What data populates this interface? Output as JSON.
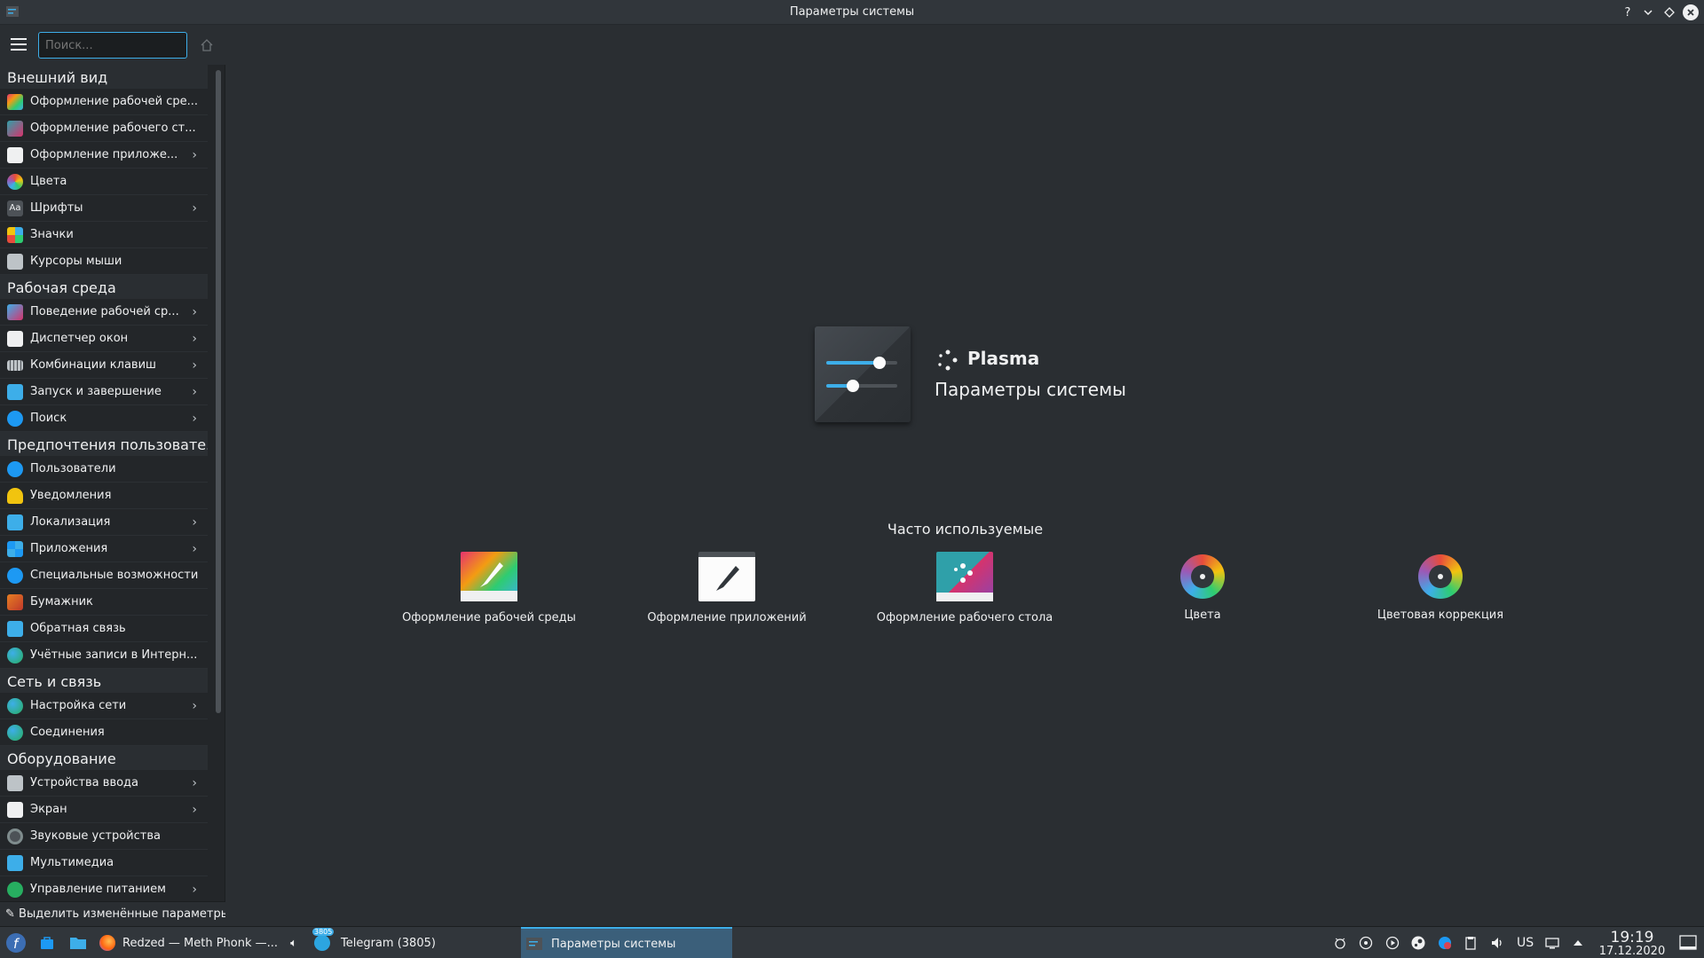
{
  "window": {
    "title": "Параметры системы"
  },
  "search": {
    "placeholder": "Поиск..."
  },
  "sidebar": {
    "groups": [
      {
        "header": "Внешний вид",
        "items": [
          {
            "label": "Оформление рабочей сре...",
            "icon": "global-theme-icon",
            "color": "#e5326f",
            "arrow": false
          },
          {
            "label": "Оформление рабочего ст...",
            "icon": "plasma-style-icon",
            "color": "#2fa0a9",
            "arrow": false
          },
          {
            "label": "Оформление приложе...",
            "icon": "application-style-icon",
            "color": "#eff0f1",
            "arrow": true
          },
          {
            "label": "Цвета",
            "icon": "colors-icon",
            "color": "#c83ae0",
            "arrow": false
          },
          {
            "label": "Шрифты",
            "icon": "fonts-icon",
            "color": "#4d5257",
            "arrow": true
          },
          {
            "label": "Значки",
            "icon": "icons-icon",
            "color": "#3daee9",
            "arrow": false
          },
          {
            "label": "Курсоры мыши",
            "icon": "cursor-icon",
            "color": "#bdc3c7",
            "arrow": false
          }
        ]
      },
      {
        "header": "Рабочая среда",
        "items": [
          {
            "label": "Поведение рабочей ср...",
            "icon": "workspace-behavior-icon",
            "color": "#3daee9",
            "arrow": true
          },
          {
            "label": "Диспетчер окон",
            "icon": "window-manager-icon",
            "color": "#eff0f1",
            "arrow": true
          },
          {
            "label": "Комбинации клавиш",
            "icon": "shortcuts-icon",
            "color": "#bdc3c7",
            "arrow": true
          },
          {
            "label": "Запуск и завершение",
            "icon": "startup-icon",
            "color": "#3daee9",
            "arrow": true
          },
          {
            "label": "Поиск",
            "icon": "search-settings-icon",
            "color": "#1d99f3",
            "arrow": true
          }
        ]
      },
      {
        "header": "Предпочтения пользовате...",
        "items": [
          {
            "label": "Пользователи",
            "icon": "users-icon",
            "color": "#1d99f3",
            "arrow": false
          },
          {
            "label": "Уведомления",
            "icon": "notifications-icon",
            "color": "#f1c40f",
            "arrow": false
          },
          {
            "label": "Локализация",
            "icon": "localization-icon",
            "color": "#3daee9",
            "arrow": true
          },
          {
            "label": "Приложения",
            "icon": "applications-icon",
            "color": "#3daee9",
            "arrow": true
          },
          {
            "label": "Специальные возможности",
            "icon": "accessibility-icon",
            "color": "#1d99f3",
            "arrow": false
          },
          {
            "label": "Бумажник",
            "icon": "wallet-icon",
            "color": "#e67e22",
            "arrow": false
          },
          {
            "label": "Обратная связь",
            "icon": "feedback-icon",
            "color": "#3daee9",
            "arrow": false
          },
          {
            "label": "Учётные записи в Интерн...",
            "icon": "online-accounts-icon",
            "color": "#27ae60",
            "arrow": false
          }
        ]
      },
      {
        "header": "Сеть и связь",
        "items": [
          {
            "label": "Настройка сети",
            "icon": "network-settings-icon",
            "color": "#27ae60",
            "arrow": true
          },
          {
            "label": "Соединения",
            "icon": "connections-icon",
            "color": "#27ae60",
            "arrow": false
          }
        ]
      },
      {
        "header": "Оборудование",
        "items": [
          {
            "label": "Устройства ввода",
            "icon": "input-devices-icon",
            "color": "#bdc3c7",
            "arrow": true
          },
          {
            "label": "Экран",
            "icon": "display-icon",
            "color": "#eff0f1",
            "arrow": true
          },
          {
            "label": "Звуковые устройства",
            "icon": "audio-devices-icon",
            "color": "#7f8c8d",
            "arrow": false
          },
          {
            "label": "Мультимедиа",
            "icon": "multimedia-icon",
            "color": "#3daee9",
            "arrow": false
          },
          {
            "label": "Управление питанием",
            "icon": "power-management-icon",
            "color": "#27ae60",
            "arrow": true
          }
        ]
      }
    ],
    "footer_label": "Выделить изменённые параметры"
  },
  "hero": {
    "brand": "Plasma",
    "subtitle": "Параметры системы"
  },
  "frequent": {
    "title": "Часто используемые",
    "items": [
      {
        "label": "Оформление рабочей среды",
        "icon": "global-theme-icon"
      },
      {
        "label": "Оформление приложений",
        "icon": "application-style-icon"
      },
      {
        "label": "Оформление рабочего стола",
        "icon": "plasma-style-icon"
      },
      {
        "label": "Цвета",
        "icon": "colors-icon"
      },
      {
        "label": "Цветовая коррекция",
        "icon": "color-correction-icon"
      }
    ]
  },
  "taskbar": {
    "tasks": [
      {
        "label": "Redzed — Meth Phonk —...",
        "icon": "firefox-icon"
      },
      {
        "label": "Telegram (3805)",
        "icon": "telegram-icon",
        "badge": "3805"
      },
      {
        "label": "Параметры системы",
        "icon": "system-settings-icon",
        "active": true
      }
    ],
    "keyboard_layout": "US",
    "time": "19:19",
    "date": "17.12.2020"
  }
}
